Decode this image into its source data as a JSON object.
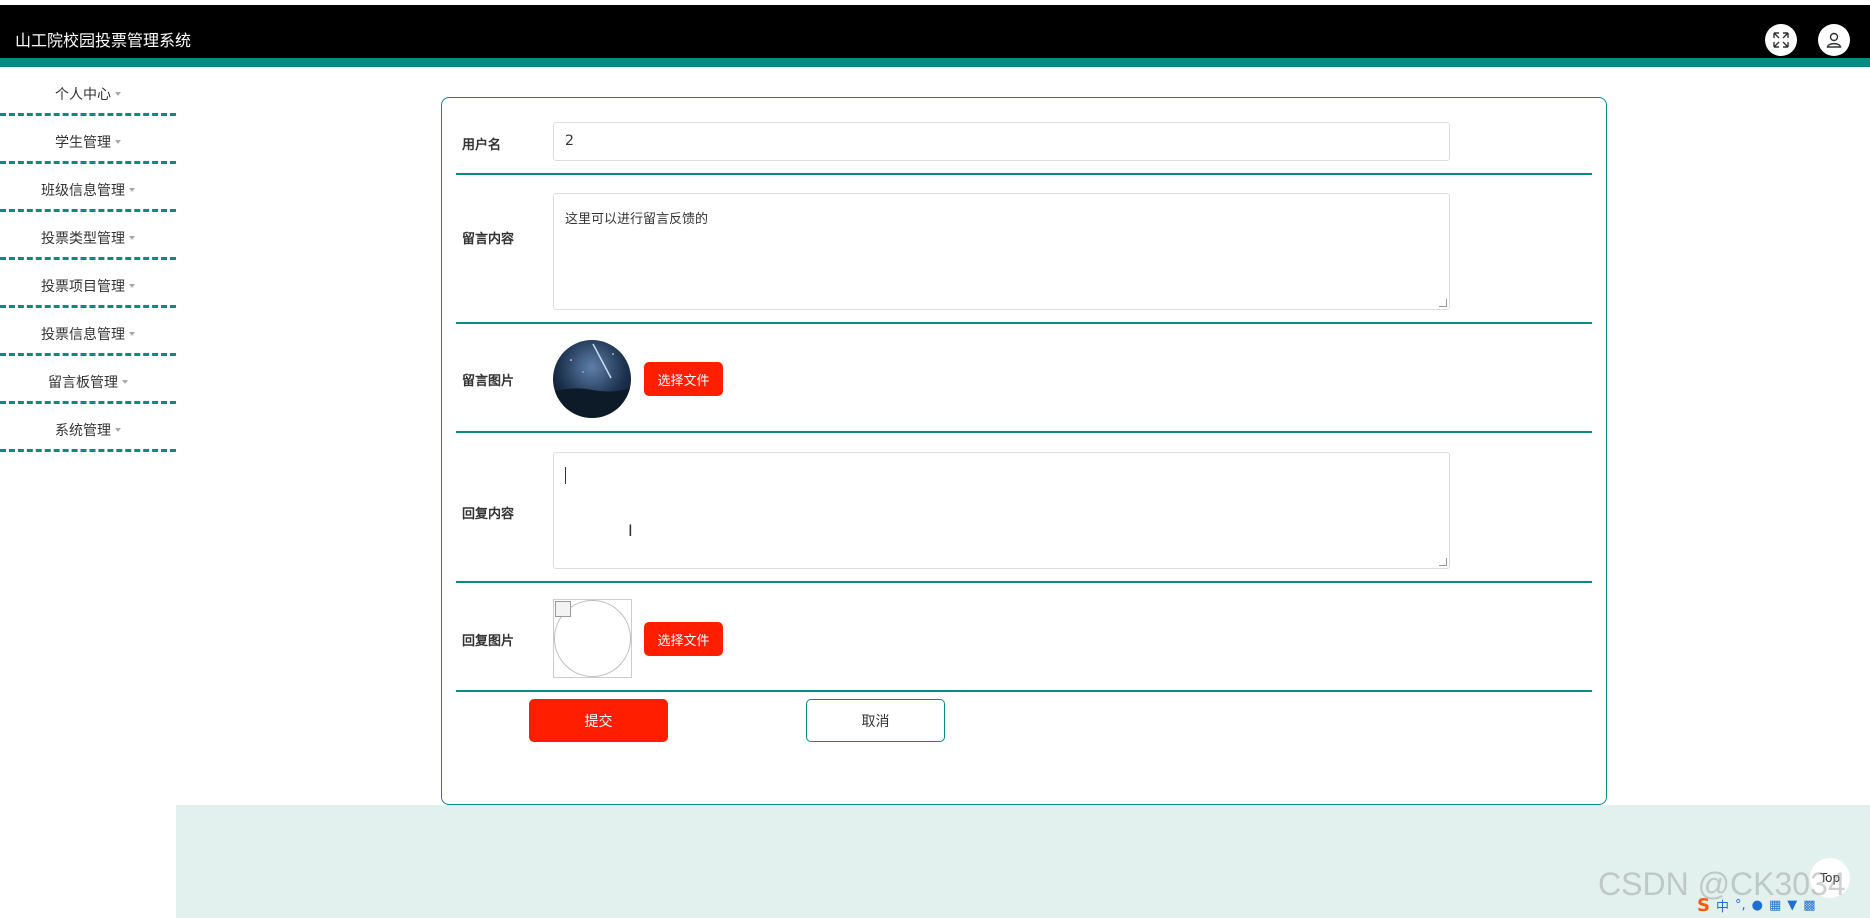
{
  "header": {
    "app_title": "山工院校园投票管理系统",
    "fullscreen_icon": "expand-icon",
    "user_icon": "user-icon"
  },
  "sidebar": {
    "items": [
      {
        "label": "个人中心"
      },
      {
        "label": "学生管理"
      },
      {
        "label": "班级信息管理"
      },
      {
        "label": "投票类型管理"
      },
      {
        "label": "投票项目管理"
      },
      {
        "label": "投票信息管理"
      },
      {
        "label": "留言板管理"
      },
      {
        "label": "系统管理"
      }
    ]
  },
  "form": {
    "username_label": "用户名",
    "username_value": "2",
    "message_label": "留言内容",
    "message_value": "这里可以进行留言反馈的",
    "message_image_label": "留言图片",
    "message_image_button": "选择文件",
    "reply_label": "回复内容",
    "reply_value": "",
    "reply_image_label": "回复图片",
    "reply_image_button": "选择文件",
    "submit_label": "提交",
    "cancel_label": "取消"
  },
  "misc": {
    "top_button": "Top",
    "watermark": "CSDN @CK3034",
    "ime_label": "中"
  },
  "colors": {
    "accent": "#0b8a85",
    "primary_button": "#ff1e00",
    "footer_band": "#e2f1ed"
  }
}
